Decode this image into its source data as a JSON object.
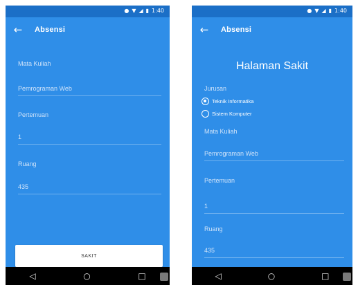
{
  "status_bar": {
    "icons": [
      "location-icon",
      "wifi-icon",
      "signal-icon",
      "battery-icon"
    ],
    "time": "1:40"
  },
  "app_bar": {
    "back_icon": "←",
    "title": "Absensi"
  },
  "left_screen": {
    "fields": [
      {
        "label": "Mata Kuliah",
        "value": "Pemrograman Web"
      },
      {
        "label": "Pertemuan",
        "value": "1"
      },
      {
        "label": "Ruang",
        "value": "435"
      }
    ],
    "button_label": "SAKIT"
  },
  "right_screen": {
    "heading": "Halaman Sakit",
    "jurusan_label": "Jurusan",
    "radio_options": [
      {
        "label": "Teknik Informatika",
        "selected": true
      },
      {
        "label": "Sistem Komputer",
        "selected": false
      }
    ],
    "fields": [
      {
        "label": "Mata Kuliah",
        "value": "Pemrograman Web"
      },
      {
        "label": "Pertemuan",
        "value": "1"
      },
      {
        "label": "Ruang",
        "value": "435"
      }
    ]
  },
  "nav_bar": {
    "back": "◁",
    "home": "○",
    "recents": "□"
  },
  "colors": {
    "primary": "#2f8ee8",
    "status_bar": "#1b6fc7",
    "nav_bar": "#000000"
  }
}
